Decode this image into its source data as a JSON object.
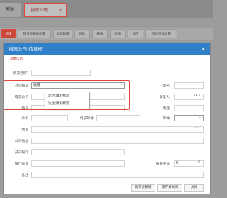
{
  "top_tabs": [
    {
      "label": "帮助"
    },
    {
      "label": "物流公司"
    }
  ],
  "toolbar": {
    "buttons": [
      "新增",
      "物流单模板配置",
      "复制新增",
      "修改",
      "删除",
      "查询",
      "停用",
      "物流单号设置"
    ]
  },
  "modal": {
    "title": "物流公司-信息框",
    "tab": "基本信息",
    "fields": {
      "company_name_label": "物流名称",
      "short_name_label": "简名",
      "interface_code_label": "对应编号",
      "interface_code_value": "通用",
      "company_code_label": "物流公司",
      "contact_label": "联系人",
      "code_label": "编号",
      "phone_label": "电话",
      "mobile_label": "手机",
      "email_label": "电子邮件",
      "currency_label": "币种",
      "address_label": "地址",
      "company_address_label": "公司地址",
      "bank_label": "开户银行",
      "bank_account_label": "银行账号",
      "settle_days_label": "账期天数",
      "settle_days_value": "0",
      "remark_label": "备注"
    },
    "dropdown_options": [
      "达达(康彩物流)",
      "达达(康彩物流)"
    ],
    "footer_buttons": {
      "save_new": "保存并新增",
      "save_close": "保存并关闭",
      "close": "关闭"
    }
  }
}
